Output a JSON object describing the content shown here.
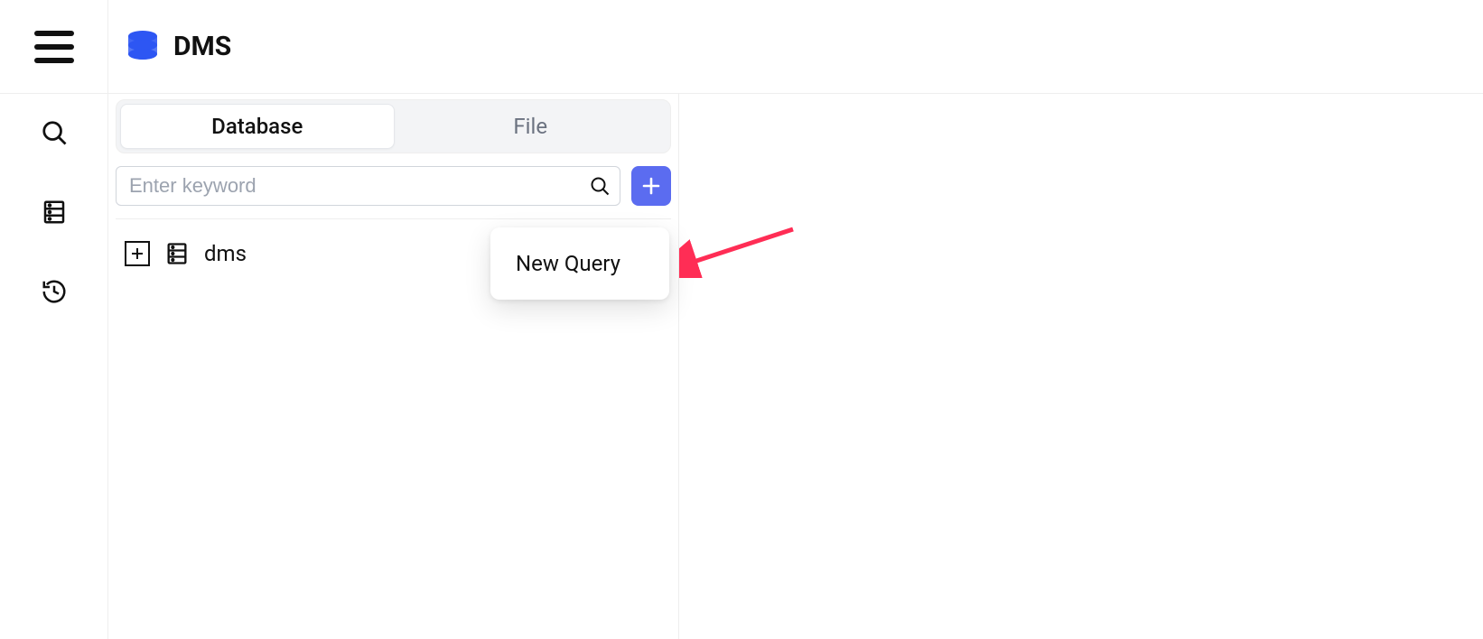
{
  "app": {
    "title": "DMS"
  },
  "sidepanel": {
    "tabs": [
      {
        "label": "Database",
        "active": true
      },
      {
        "label": "File",
        "active": false
      }
    ],
    "search": {
      "placeholder": "Enter keyword"
    },
    "tree": {
      "items": [
        {
          "label": "dms"
        }
      ]
    }
  },
  "popover": {
    "items": [
      {
        "label": "New Query"
      }
    ]
  }
}
